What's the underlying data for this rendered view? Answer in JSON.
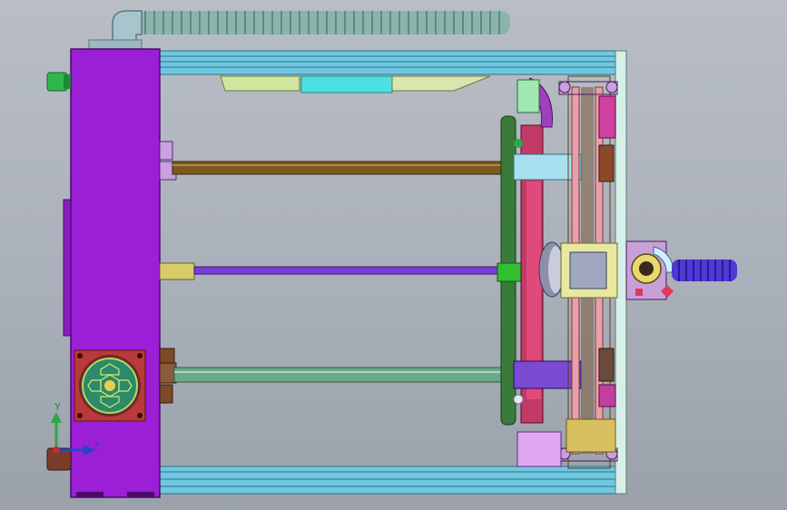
{
  "viewport": {
    "colors": {
      "background_top": "#b9bec6",
      "background_bottom": "#9aa1ab",
      "housing": "#9b1fd6",
      "frame_rail": "#6fc8e0",
      "side_plate": "#d6f0e8",
      "rod_brown": "#7a5a1e",
      "rod_purple": "#7b3ad8",
      "rod_green": "#6aa88a",
      "belt": "#e8a0a8",
      "flex_hose": "#8bb4ad",
      "blue_spring": "#4d38d8"
    }
  },
  "triad": {
    "y_label": "Y",
    "z_label": "Z"
  }
}
